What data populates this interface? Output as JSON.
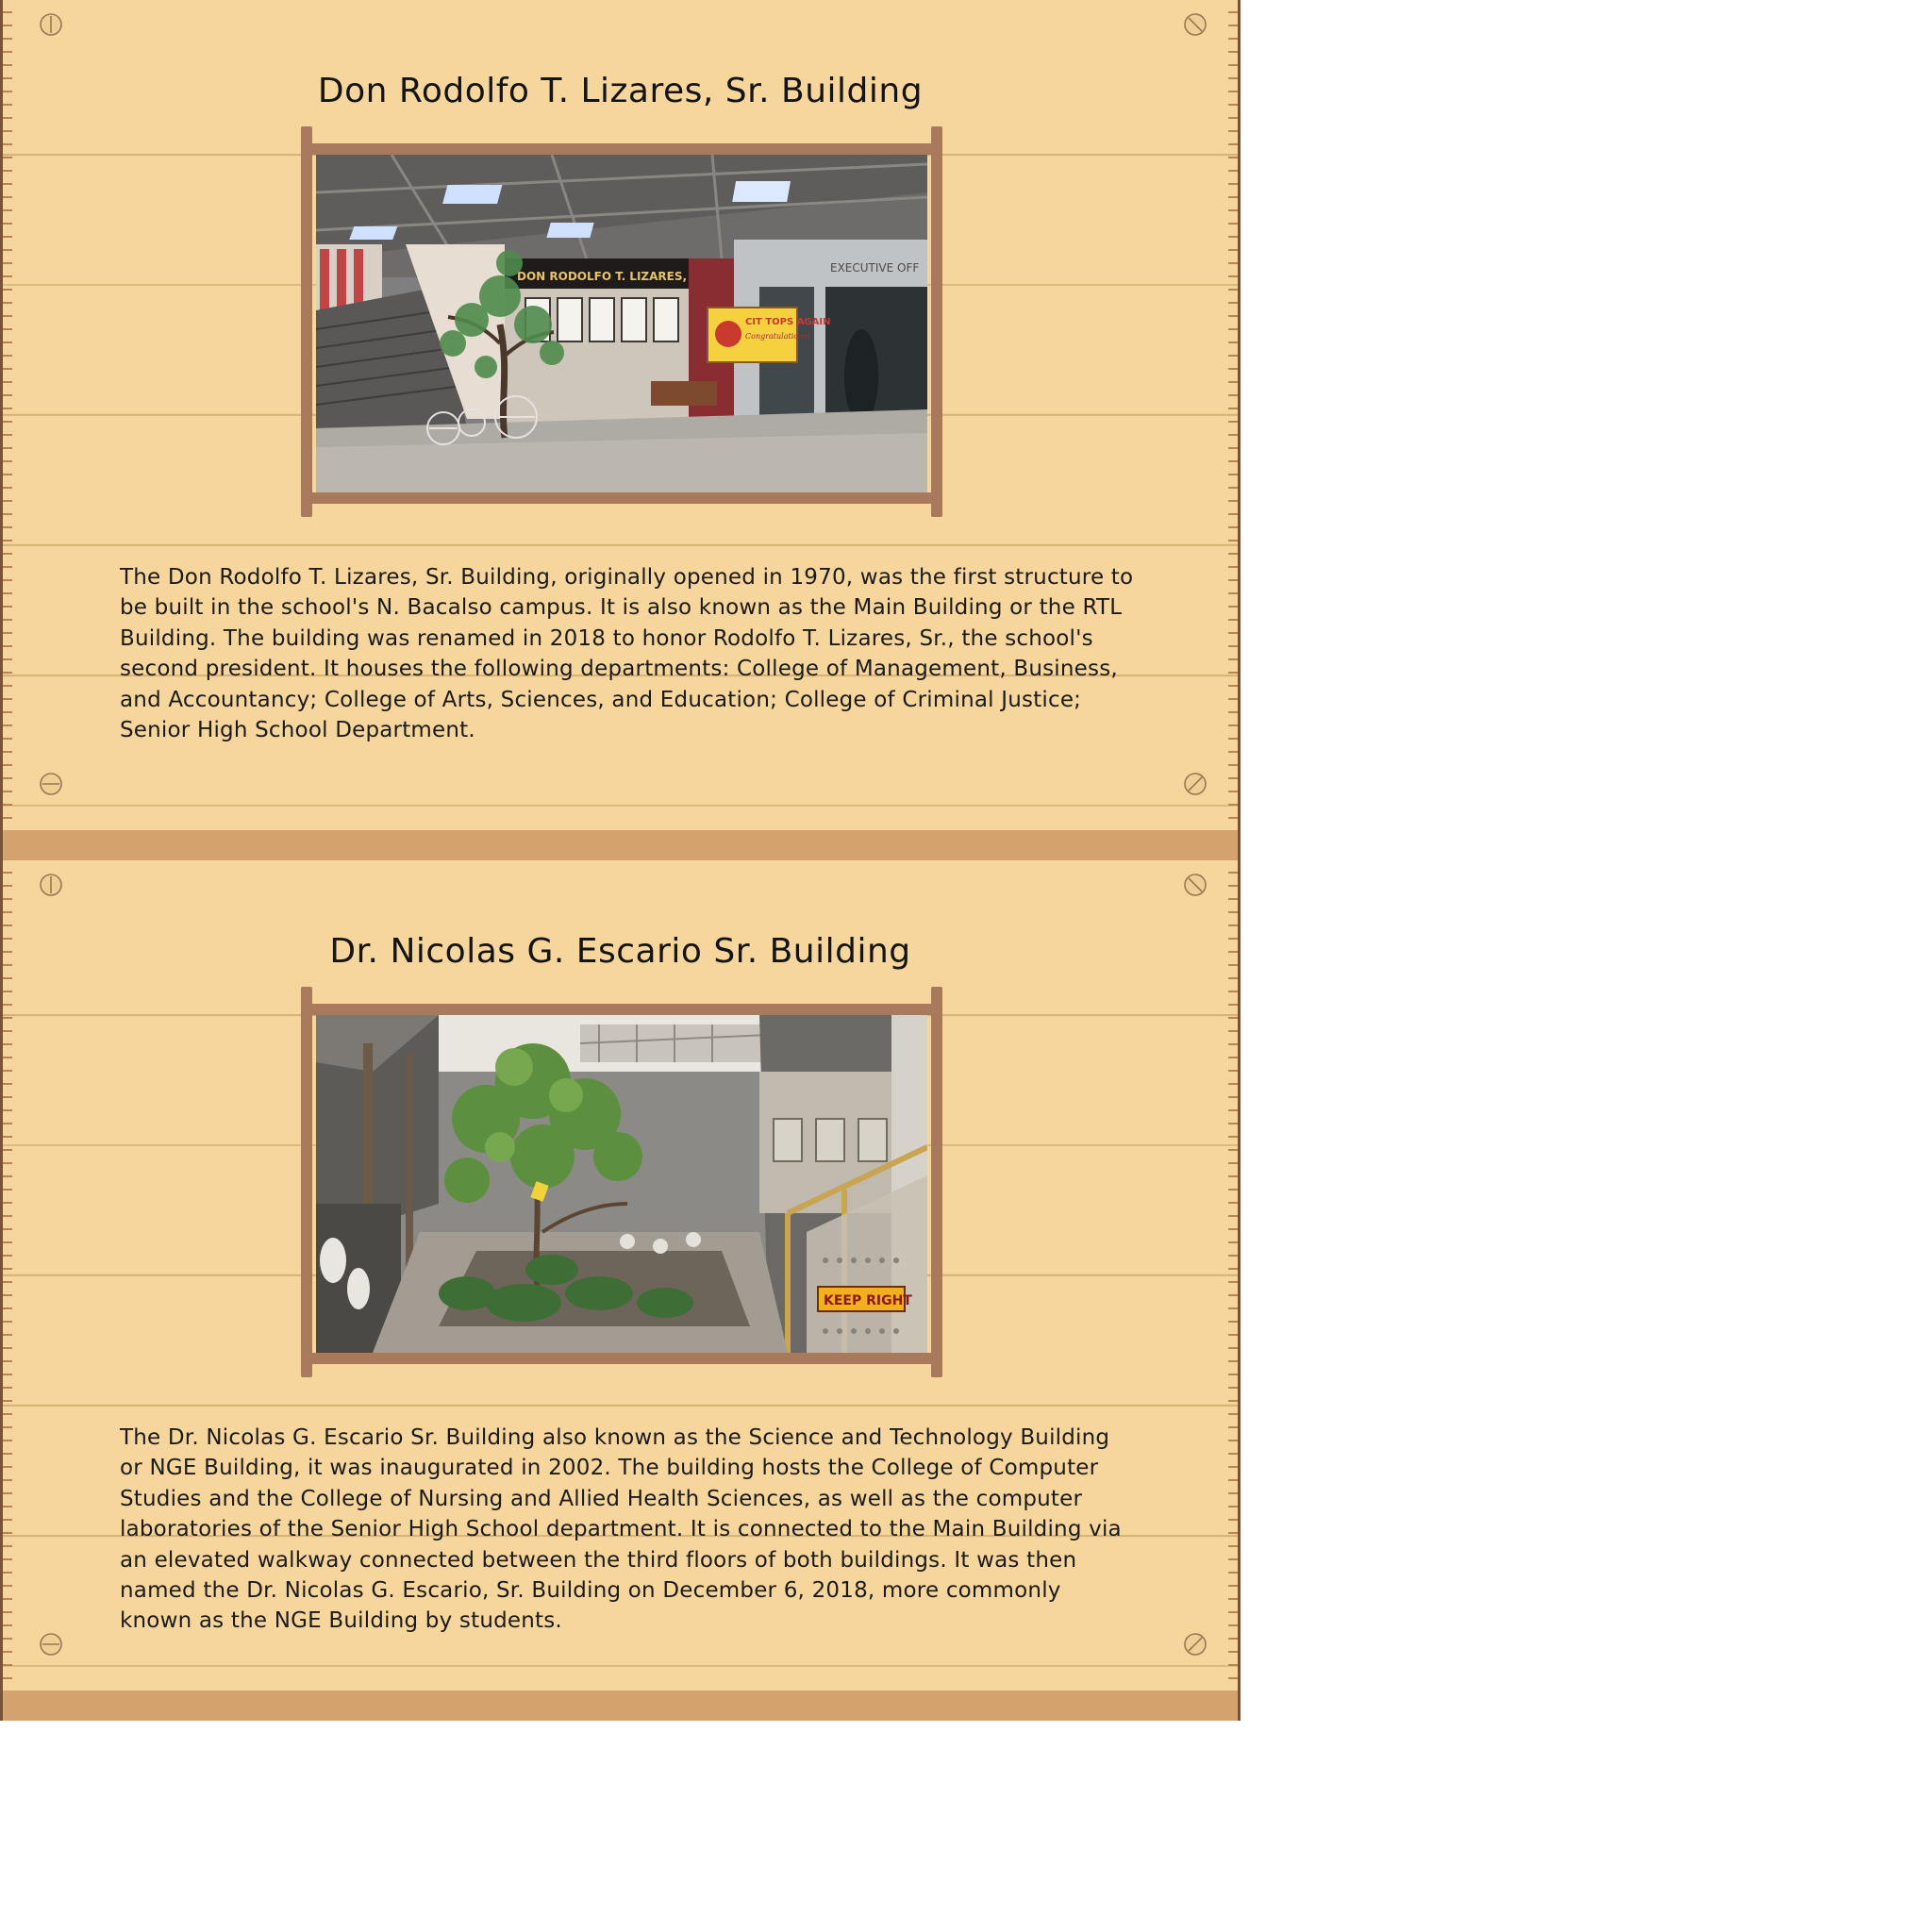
{
  "sections": [
    {
      "title": "Don Rodolfo T. Lizares, Sr. Building",
      "photo_icon": "building-lobby-photo",
      "description": "The Don Rodolfo T. Lizares, Sr. Building, originally opened in 1970, was the first structure to be built in the school's N. Bacalso campus. It is also known as the Main Building or the RTL Building. The building was renamed in 2018 to honor Rodolfo T. Lizares, Sr., the school's second president. It houses the following departments: College of Management, Business, and Accountancy; College of Arts, Sciences, and Education; College of Criminal Justice; Senior High School Department.",
      "photo_text": {
        "sign": "DON RODOLFO T. LIZARES, SR. BUILDING",
        "office": "EXECUTIVE OFF",
        "banner_title": "CIT TOPS AGAIN",
        "banner_sub": "Congratulations!"
      }
    },
    {
      "title": "Dr. Nicolas G. Escario Sr. Building",
      "photo_icon": "courtyard-photo",
      "description": "The Dr. Nicolas G. Escario Sr. Building also known as the Science and Technology Building or NGE Building, it was inaugurated in 2002. The building hosts the College of Computer Studies and the College of Nursing and Allied Health Sciences, as well as the computer laboratories of the Senior High School department. It is connected to the Main Building via an elevated walkway connected between the third floors of both buildings. It was then named the Dr. Nicolas G. Escario, Sr. Building on December 6, 2018, more commonly known as the NGE Building by students.",
      "photo_text": {
        "sign": "KEEP RIGHT"
      }
    }
  ],
  "colors": {
    "board": "#f6d69c",
    "board_edge": "#d4a26d",
    "frame": "#a8795a",
    "text": "#1b1b1b"
  },
  "icons": [
    "screw-icon"
  ]
}
